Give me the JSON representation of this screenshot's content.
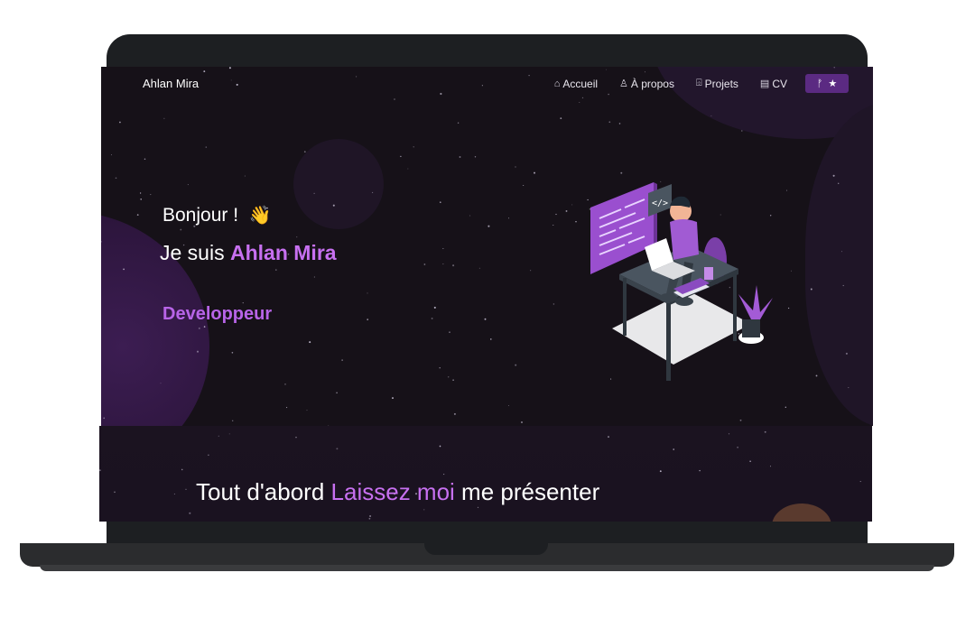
{
  "nav": {
    "brand": "Ahlan Mira",
    "items": [
      {
        "icon": "home-icon",
        "label": "Accueil"
      },
      {
        "icon": "user-icon",
        "label": "À propos"
      },
      {
        "icon": "projects-icon",
        "label": "Projets"
      },
      {
        "icon": "document-icon",
        "label": "CV"
      }
    ],
    "star_button": {
      "fork_icon": "ᚠ",
      "star_icon": "★"
    }
  },
  "hero": {
    "greeting": "Bonjour !",
    "wave_icon": "👋",
    "intro_prefix": "Je suis",
    "name": "Ahlan Mira",
    "role": "Developpeur"
  },
  "about": {
    "prefix": "Tout d'abord",
    "accent": "Laissez moi",
    "suffix": "me présenter"
  },
  "colors": {
    "accent": "#c770f0",
    "background": "#161118",
    "button": "#5b2a82"
  }
}
